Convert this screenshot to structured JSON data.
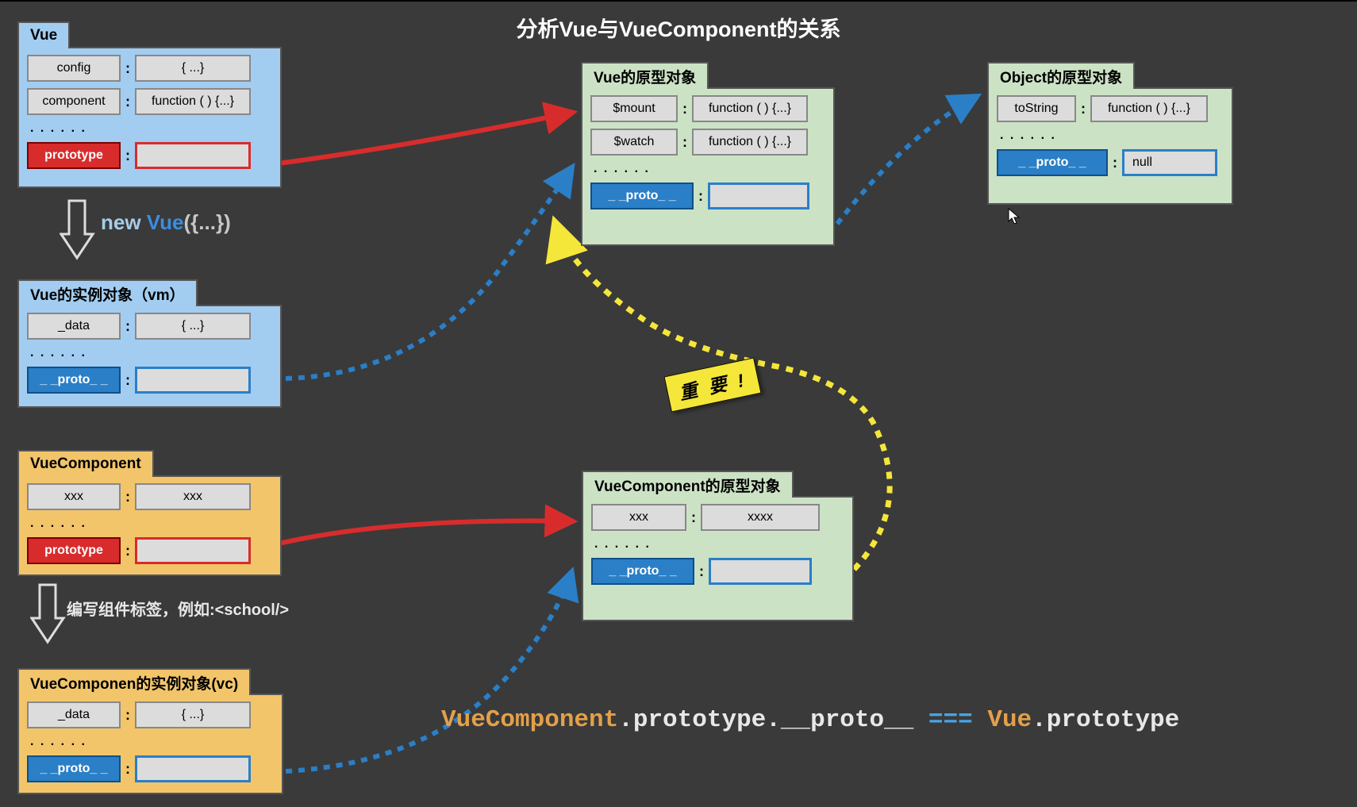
{
  "title": "分析Vue与VueComponent的关系",
  "boxes": {
    "vue": {
      "tab": "Vue",
      "rows": [
        {
          "key": "config",
          "val": "{ ...}"
        },
        {
          "key": "component",
          "val": "function ( ) {...}"
        }
      ],
      "dots": ". . . . . .",
      "proto_key": "prototype",
      "proto_val": ""
    },
    "vm": {
      "tab": "Vue的实例对象（vm）",
      "rows": [
        {
          "key": "_data",
          "val": "{ ...}"
        }
      ],
      "dots": ". . . . . .",
      "proto_key": "_ _proto_ _",
      "proto_val": ""
    },
    "vuecomp": {
      "tab": "VueComponent",
      "rows": [
        {
          "key": "xxx",
          "val": "xxx"
        }
      ],
      "dots": ". . . . . .",
      "proto_key": "prototype",
      "proto_val": ""
    },
    "vc": {
      "tab": "VueComponen的实例对象(vc)",
      "rows": [
        {
          "key": "_data",
          "val": "{ ...}"
        }
      ],
      "dots": ". . . . . .",
      "proto_key": "_ _proto_ _",
      "proto_val": ""
    },
    "vueproto": {
      "tab": "Vue的原型对象",
      "rows": [
        {
          "key": "$mount",
          "val": "function ( ) {...}"
        },
        {
          "key": "$watch",
          "val": "function ( ) {...}"
        }
      ],
      "dots": ". . . . . .",
      "proto_key": "_ _proto_ _",
      "proto_val": ""
    },
    "vcproto": {
      "tab": "VueComponent的原型对象",
      "rows": [
        {
          "key": "xxx",
          "val": "xxxx"
        }
      ],
      "dots": ". . . . . .",
      "proto_key": "_ _proto_ _",
      "proto_val": ""
    },
    "objproto": {
      "tab": "Object的原型对象",
      "rows": [
        {
          "key": "toString",
          "val": "function ( ) {...}"
        }
      ],
      "dots": ". . . . . .",
      "proto_key": "_ _proto_ _",
      "proto_val": "null"
    }
  },
  "labels": {
    "new_vue": {
      "kw_new": "new ",
      "kw_vue": "Vue",
      "kw_paren": "({...})"
    },
    "comp_tag": "编写组件标签，例如:<school/>",
    "important": "重 要 !"
  },
  "code": {
    "p1": "VueComponent",
    "p2": ".prototype.__proto__ ",
    "p3": "=== ",
    "p4": "Vue",
    "p5": ".prototype"
  }
}
